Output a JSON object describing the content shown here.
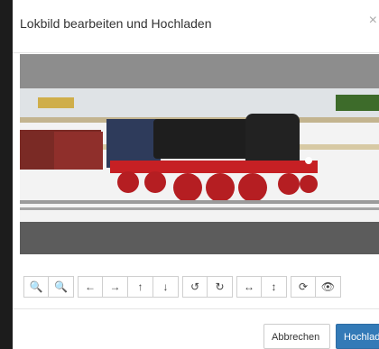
{
  "dialog": {
    "title": "Lokbild bearbeiten und Hochladen",
    "close_label": "×"
  },
  "editor": {
    "image_subject": "steam-locomotive-photo"
  },
  "toolbar": {
    "groups": [
      {
        "buttons": [
          {
            "name": "zoom-in-button",
            "icon": "zoom-in-icon",
            "glyph": "🔍"
          },
          {
            "name": "zoom-out-button",
            "icon": "zoom-out-icon",
            "glyph": "🔍"
          }
        ]
      },
      {
        "buttons": [
          {
            "name": "move-left-button",
            "icon": "arrow-left-icon",
            "glyph": "←"
          },
          {
            "name": "move-right-button",
            "icon": "arrow-right-icon",
            "glyph": "→"
          },
          {
            "name": "move-up-button",
            "icon": "arrow-up-icon",
            "glyph": "↑"
          },
          {
            "name": "move-down-button",
            "icon": "arrow-down-icon",
            "glyph": "↓"
          }
        ]
      },
      {
        "buttons": [
          {
            "name": "rotate-left-button",
            "icon": "rotate-left-icon",
            "glyph": "↺"
          },
          {
            "name": "rotate-right-button",
            "icon": "rotate-right-icon",
            "glyph": "↻"
          }
        ]
      },
      {
        "buttons": [
          {
            "name": "flip-horizontal-button",
            "icon": "flip-horizontal-icon",
            "glyph": "↔"
          },
          {
            "name": "flip-vertical-button",
            "icon": "flip-vertical-icon",
            "glyph": "↕"
          }
        ]
      },
      {
        "buttons": [
          {
            "name": "reset-button",
            "icon": "refresh-icon",
            "glyph": "⟳"
          },
          {
            "name": "preview-button",
            "icon": "eye-icon",
            "glyph": "👁"
          }
        ]
      }
    ]
  },
  "footer": {
    "cancel_label": "Abbrechen",
    "upload_label": "Hochladen"
  }
}
